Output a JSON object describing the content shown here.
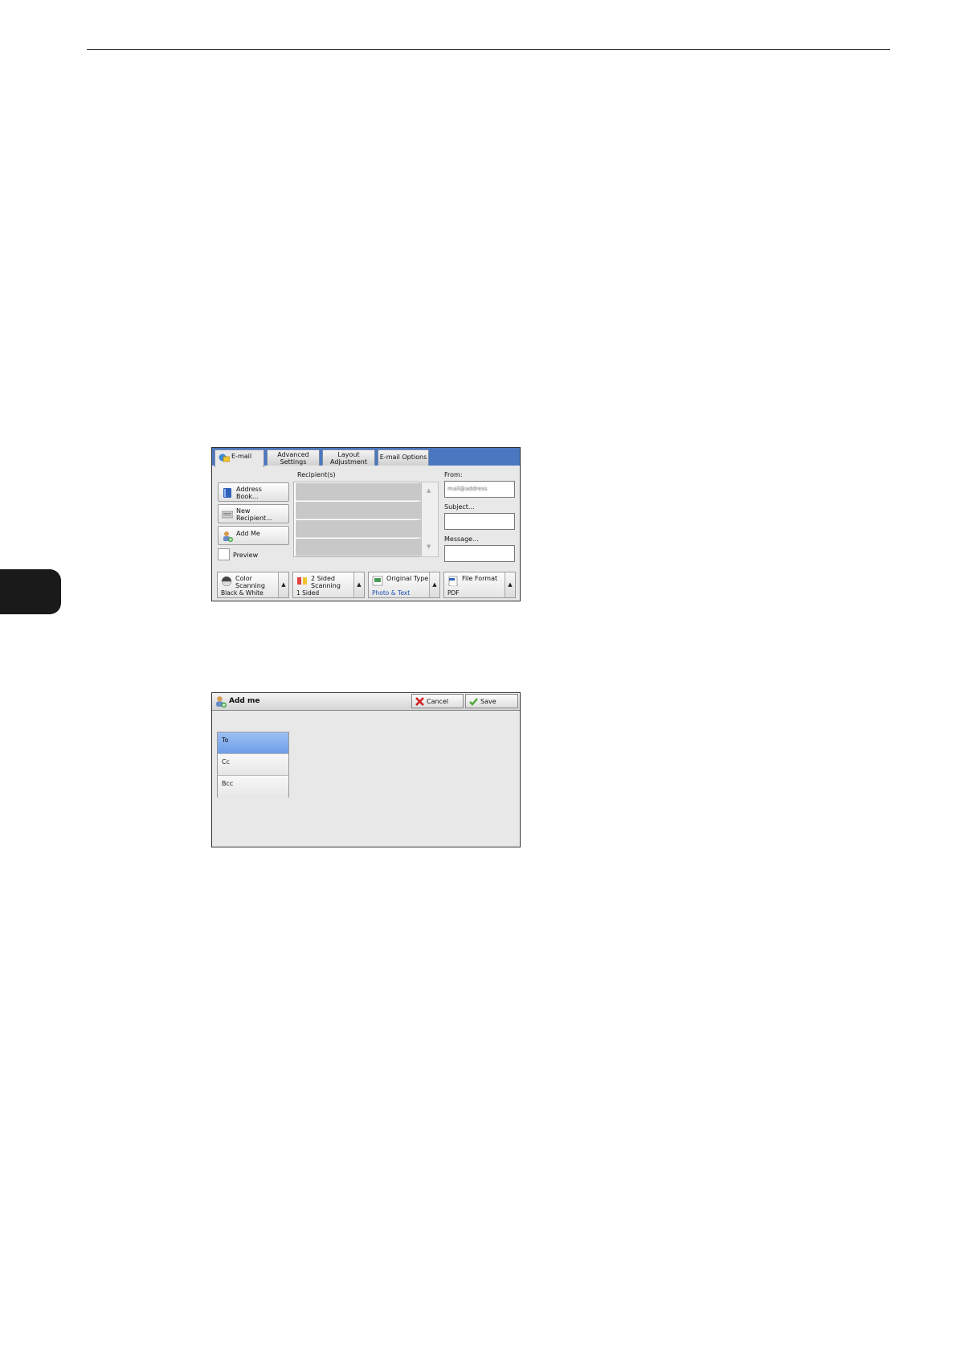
{
  "screen1": {
    "tabs": [
      {
        "label": "E-mail",
        "icon": "email-icon"
      },
      {
        "label": "Advanced\nSettings"
      },
      {
        "label": "Layout\nAdjustment"
      },
      {
        "label": "E-mail Options"
      }
    ],
    "left_buttons": [
      {
        "label": "Address\nBook...",
        "icon": "address-book-icon"
      },
      {
        "label": "New\nRecipient...",
        "icon": "keyboard-icon"
      },
      {
        "label": "Add Me",
        "icon": "add-me-icon"
      }
    ],
    "preview_label": "Preview",
    "recipients_header": "Recipient(s)",
    "from_label": "From:",
    "from_value": "mail@address",
    "subject_label": "Subject...",
    "message_label": "Message...",
    "features": [
      {
        "name": "Color\nScanning",
        "value": "Black & White",
        "icon": "color-scanning-icon"
      },
      {
        "name": "2 Sided\nScanning",
        "value": "1 Sided",
        "icon": "two-sided-icon"
      },
      {
        "name": "Original Type",
        "value": "Photo & Text",
        "icon": "original-type-icon"
      },
      {
        "name": "File Format",
        "value": "PDF",
        "icon": "file-format-icon"
      }
    ]
  },
  "screen2": {
    "title": "Add me",
    "cancel_label": "Cancel",
    "save_label": "Save",
    "options": [
      "To",
      "Cc",
      "Bcc"
    ],
    "selected": "To"
  },
  "colors": {
    "tab_bar": "#4a78c0",
    "selection": "#7aa6ec",
    "value_blue": "#2050b0"
  }
}
